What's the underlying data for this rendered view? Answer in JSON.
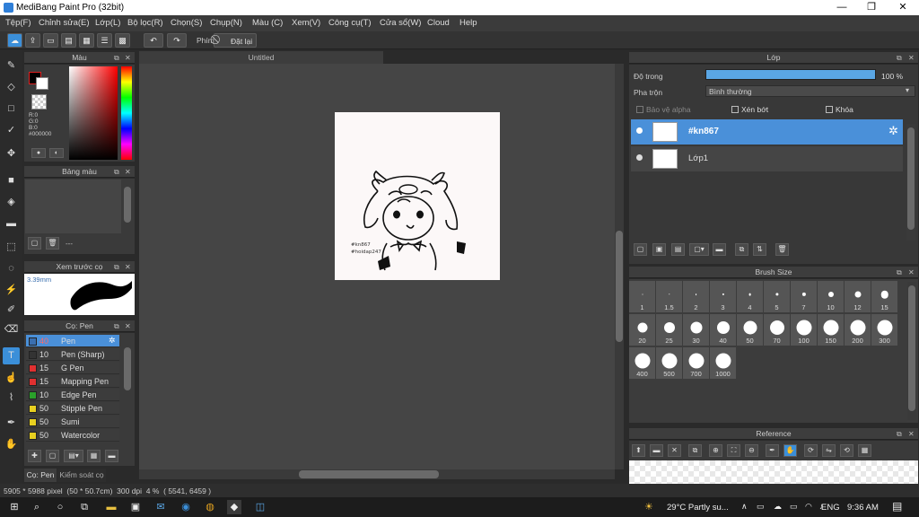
{
  "window": {
    "title": "MediBang Paint Pro (32bit)",
    "minimize": "—",
    "maximize": "❐",
    "close": "✕"
  },
  "menu": [
    "Tệp(F)",
    "Chỉnh sửa(E)",
    "Lớp(L)",
    "Bộ lọc(R)",
    "Chọn(S)",
    "Chụp(N)",
    "Màu (C)",
    "Xem(V)",
    "Công cụ(T)",
    "Cửa sổ(W)",
    "Cloud",
    "Help"
  ],
  "toolbar": {
    "phim_label": "Phím",
    "reset_label": "Đặt lại"
  },
  "color_panel": {
    "title": "Màu",
    "r": "R:0",
    "g": "G:0",
    "b": "B:0",
    "hex": "#000000",
    "primary_color": "#000000",
    "secondary_color": "#ffffff"
  },
  "palette_panel": {
    "title": "Bảng màu",
    "value": "---"
  },
  "preview_panel": {
    "title": "Xem trước cọ",
    "size": "3.39mm"
  },
  "brush_panel": {
    "title": "Cọ: Pen",
    "items": [
      {
        "size": "40",
        "name": "Pen",
        "color": "#3a6fb0",
        "selected": true
      },
      {
        "size": "10",
        "name": "Pen (Sharp)",
        "color": "#333333"
      },
      {
        "size": "15",
        "name": "G Pen",
        "color": "#e03030"
      },
      {
        "size": "15",
        "name": "Mapping Pen",
        "color": "#e03030"
      },
      {
        "size": "10",
        "name": "Edge Pen",
        "color": "#2aa02a"
      },
      {
        "size": "50",
        "name": "Stipple Pen",
        "color": "#e8d020"
      },
      {
        "size": "50",
        "name": "Sumi",
        "color": "#e8d020"
      },
      {
        "size": "50",
        "name": "Watercolor",
        "color": "#e8d020"
      }
    ]
  },
  "bottom_tabs": {
    "brush": "Cọ: Pen",
    "brush_control": "Kiểm soát cọ"
  },
  "document": {
    "tab_title": "Untitled",
    "canvas_text_1": "#kn867",
    "canvas_text_2": "#hoidap247"
  },
  "layer_panel": {
    "title": "Lớp",
    "opacity_label": "Độ trong",
    "opacity_value": "100 %",
    "opacity_fraction": 1.0,
    "blend_label": "Pha trộn",
    "blend_value": "Bình thường",
    "protect_alpha": "Bảo vệ alpha",
    "clipping": "Xén bớt",
    "lock": "Khóa",
    "layers": [
      {
        "name": "#kn867",
        "selected": true
      },
      {
        "name": "Lớp1",
        "selected": false
      }
    ]
  },
  "brush_size_panel": {
    "title": "Brush Size",
    "sizes": [
      "1",
      "1.5",
      "2",
      "3",
      "4",
      "5",
      "7",
      "10",
      "12",
      "15",
      "20",
      "25",
      "30",
      "40",
      "50",
      "70",
      "100",
      "150",
      "200",
      "300",
      "400",
      "500",
      "700",
      "1000"
    ]
  },
  "reference_panel": {
    "title": "Reference"
  },
  "status_bar": {
    "text": "5905 * 5988 pixel  (50 * 50.7cm)  300 dpi  4 %  ( 5541, 6459 )"
  },
  "taskbar": {
    "weather": "29°C  Partly su...",
    "lang": "ENG",
    "time": "9:36 AM"
  },
  "colors": {
    "accent": "#3b8fd9",
    "selected_layer": "#4a90d9"
  }
}
